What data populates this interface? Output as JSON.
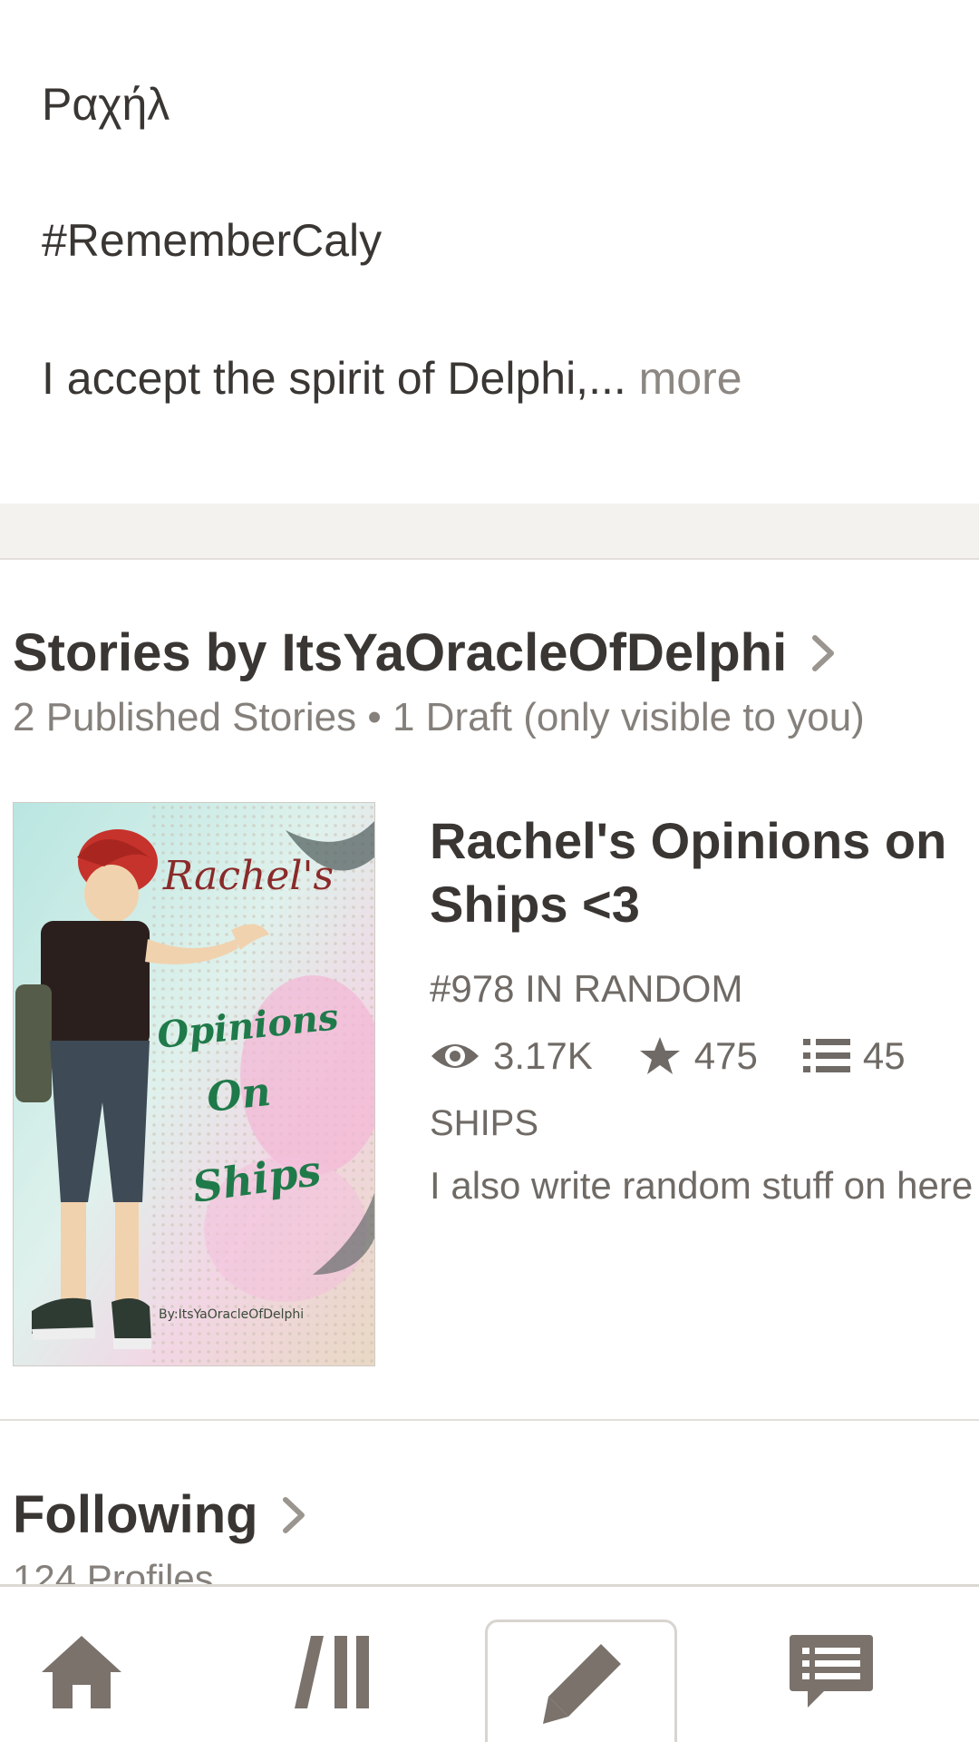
{
  "about": {
    "name_line": "Ραχήλ",
    "hashtag_line": "#RememberCaly",
    "bio_preview": "I accept the spirit of Delphi,...",
    "more_label": " more"
  },
  "stories": {
    "title": "Stories by ItsYaOracleOfDelphi",
    "subtitle": "2 Published Stories • 1 Draft (only visible to you)",
    "items": [
      {
        "cover": {
          "word1": "Rachel's",
          "word2": "Opinions",
          "word3": "On",
          "word4": "Ships",
          "byline": "By:ItsYaOracleOfDelphi"
        },
        "title": "Rachel's Opinions on Ships <3",
        "rank": "#978 IN RANDOM",
        "reads": "3.17K",
        "votes": "475",
        "parts": "45",
        "tag": "SHIPS",
        "description": "I also write random stuff on here"
      }
    ]
  },
  "following": {
    "title": "Following",
    "subtitle": "124 Profiles"
  },
  "bottom_nav": {
    "items": [
      {
        "icon": "home-icon"
      },
      {
        "icon": "library-icon"
      },
      {
        "icon": "pencil-icon",
        "selected": true
      },
      {
        "icon": "messages-icon"
      }
    ]
  },
  "colors": {
    "text_primary": "#3a3633",
    "text_secondary": "#6f6a65",
    "nav_icon": "#7a726b",
    "band_bg": "#f3f2ef"
  }
}
